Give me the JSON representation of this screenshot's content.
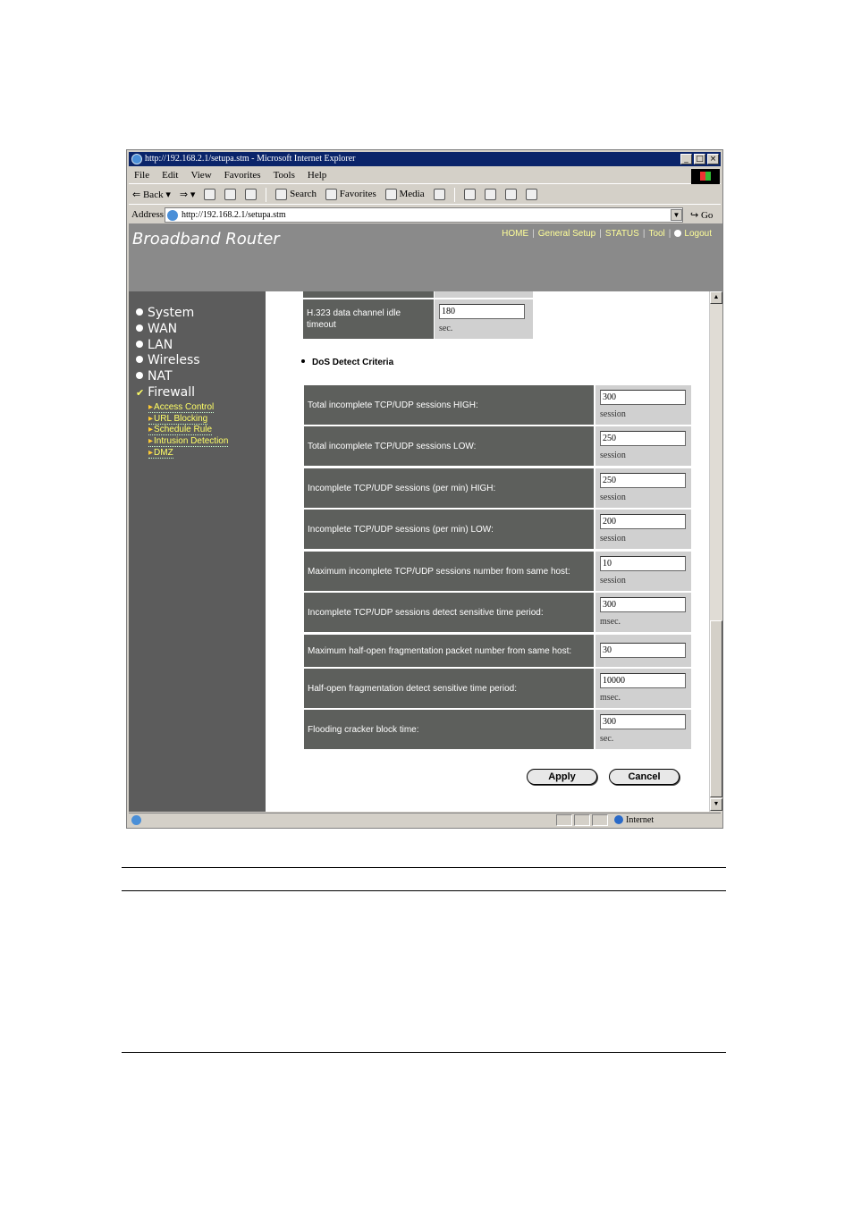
{
  "window": {
    "title": "http://192.168.2.1/setupa.stm - Microsoft Internet Explorer",
    "controls": {
      "minimize": "_",
      "maximize": "□",
      "close": "×"
    }
  },
  "menu": [
    "File",
    "Edit",
    "View",
    "Favorites",
    "Tools",
    "Help"
  ],
  "toolbar": {
    "back": "Back",
    "search": "Search",
    "favorites": "Favorites",
    "media": "Media"
  },
  "address": {
    "label": "Address",
    "url": "http://192.168.2.1/setupa.stm",
    "go": "Go"
  },
  "header": {
    "brand": "Broadband Router",
    "nav": [
      "HOME",
      "General Setup",
      "STATUS",
      "Tool",
      "Logout"
    ]
  },
  "sidebar": {
    "items": [
      "System",
      "WAN",
      "LAN",
      "Wireless",
      "NAT",
      "Firewall"
    ],
    "firewall_sub": [
      "Access Control",
      "URL Blocking",
      "Schedule Rule",
      "Intrusion Detection",
      "DMZ"
    ]
  },
  "h323": {
    "label": "H.323 data channel idle timeout",
    "value": "180",
    "unit": "sec."
  },
  "section_title": "DoS Detect Criteria",
  "dos_rows": [
    {
      "label": "Total incomplete TCP/UDP sessions HIGH:",
      "value": "300",
      "unit": "session"
    },
    {
      "label": "Total incomplete TCP/UDP sessions LOW:",
      "value": "250",
      "unit": "session"
    },
    {
      "label": "Incomplete TCP/UDP sessions (per min) HIGH:",
      "value": "250",
      "unit": "session"
    },
    {
      "label": "Incomplete TCP/UDP sessions (per min) LOW:",
      "value": "200",
      "unit": "session"
    },
    {
      "label": "Maximum incomplete TCP/UDP sessions number from same host:",
      "value": "10",
      "unit": "session"
    },
    {
      "label": "Incomplete TCP/UDP sessions detect sensitive time period:",
      "value": "300",
      "unit": "msec."
    },
    {
      "label": "Maximum half-open fragmentation packet number from same host:",
      "value": "30",
      "unit": ""
    },
    {
      "label": "Half-open fragmentation detect sensitive time period:",
      "value": "10000",
      "unit": "msec."
    },
    {
      "label": "Flooding cracker block time:",
      "value": "300",
      "unit": "sec."
    }
  ],
  "buttons": {
    "apply": "Apply",
    "cancel": "Cancel"
  },
  "status": {
    "zone": "Internet"
  }
}
